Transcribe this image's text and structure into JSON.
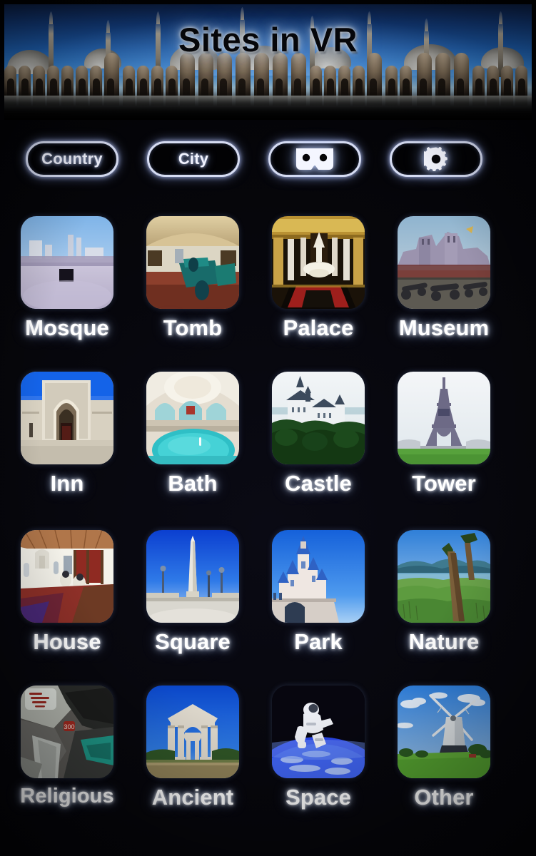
{
  "app": {
    "title": "Sites in VR",
    "background_color": "#000000",
    "accent_color": "#d6dcf2",
    "label_color": "#ffffff"
  },
  "banner": {
    "title": "Sites in VR",
    "scene": "mosque-courtyard-panorama",
    "sky_color": "#2f7fd4"
  },
  "toolbar": {
    "buttons": [
      {
        "name": "country-button",
        "label": "Country",
        "type": "text"
      },
      {
        "name": "city-button",
        "label": "City",
        "type": "text"
      },
      {
        "name": "vr-mode-button",
        "label": "",
        "type": "icon",
        "icon": "vr-cardboard-icon"
      },
      {
        "name": "settings-button",
        "label": "",
        "type": "icon",
        "icon": "gear-icon"
      }
    ]
  },
  "grid": {
    "columns": 4,
    "rows": 4,
    "items": [
      {
        "label": "Mosque",
        "thumb": "kaaba-mecca-thumb"
      },
      {
        "label": "Tomb",
        "thumb": "tomb-interior-thumb"
      },
      {
        "label": "Palace",
        "thumb": "palace-hall-thumb"
      },
      {
        "label": "Museum",
        "thumb": "panorama-cannons-thumb"
      },
      {
        "label": "Inn",
        "thumb": "caravanserai-portal-thumb"
      },
      {
        "label": "Bath",
        "thumb": "hammam-pool-thumb"
      },
      {
        "label": "Castle",
        "thumb": "neuschwanstein-thumb"
      },
      {
        "label": "Tower",
        "thumb": "eiffel-tower-thumb"
      },
      {
        "label": "House",
        "thumb": "traditional-house-interior-thumb"
      },
      {
        "label": "Square",
        "thumb": "obelisk-square-thumb"
      },
      {
        "label": "Park",
        "thumb": "fairytale-castle-thumb"
      },
      {
        "label": "Nature",
        "thumb": "lake-trees-thumb"
      },
      {
        "label": "Religious",
        "thumb": "cave-hira-thumb"
      },
      {
        "label": "Ancient",
        "thumb": "tetrapylon-ruins-thumb"
      },
      {
        "label": "Space",
        "thumb": "astronaut-earth-thumb"
      },
      {
        "label": "Other",
        "thumb": "windmill-field-thumb"
      }
    ]
  }
}
